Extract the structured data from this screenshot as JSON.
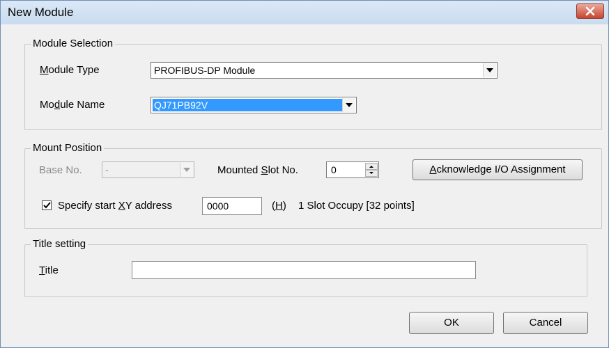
{
  "window": {
    "title": "New Module"
  },
  "module_selection": {
    "legend": "Module Selection",
    "type_label_pre": "",
    "type_label_u": "M",
    "type_label_post": "odule Type",
    "type_value": "PROFIBUS-DP Module",
    "name_label_pre": "Mo",
    "name_label_u": "d",
    "name_label_post": "ule Name",
    "name_value": "QJ71PB92V"
  },
  "mount_position": {
    "legend": "Mount Position",
    "base_label": "Base No.",
    "base_value": "-",
    "slot_label_pre": "Mounted ",
    "slot_label_u": "S",
    "slot_label_post": "lot No.",
    "slot_value": "0",
    "ack_pre": "",
    "ack_u": "A",
    "ack_post": "cknowledge I/O Assignment",
    "specify_pre": "Specify start ",
    "specify_u": "X",
    "specify_post": "Y address",
    "specify_checked": true,
    "xy_value": "0000",
    "hex_label_pre": "(",
    "hex_label_u": "H",
    "hex_label_post": ")",
    "occupy_text": "1 Slot Occupy [32 points]"
  },
  "title_setting": {
    "legend": "Title setting",
    "title_label_u": "T",
    "title_label_post": "itle",
    "title_value": ""
  },
  "buttons": {
    "ok": "OK",
    "cancel": "Cancel"
  },
  "colors": {
    "selection": "#3399ff",
    "close": "#c7452f"
  }
}
